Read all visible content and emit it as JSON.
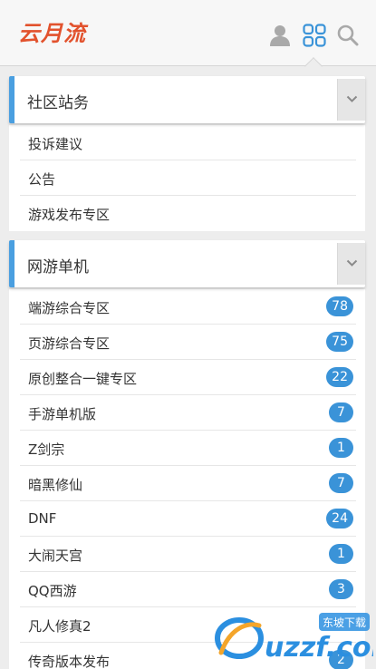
{
  "header": {
    "logo_text": "云月流",
    "icons": [
      "user-icon",
      "apps-grid-icon",
      "search-icon"
    ],
    "accent_color": "#4a9fe0",
    "logo_color": "#e2522d"
  },
  "sections": [
    {
      "title": "社区站务",
      "items": [
        {
          "label": "投诉建议"
        },
        {
          "label": "公告"
        },
        {
          "label": "游戏发布专区"
        }
      ]
    },
    {
      "title": "网游单机",
      "items": [
        {
          "label": "端游综合专区",
          "count": "78"
        },
        {
          "label": "页游综合专区",
          "count": "75"
        },
        {
          "label": "原创整合一键专区",
          "count": "22"
        },
        {
          "label": "手游单机版",
          "count": "7"
        },
        {
          "label": "Z剑宗",
          "count": "1"
        },
        {
          "label": "暗黑修仙",
          "count": "7"
        },
        {
          "label": "DNF",
          "count": "24"
        },
        {
          "label": "大闹天宫",
          "count": "1"
        },
        {
          "label": "QQ西游",
          "count": "3"
        },
        {
          "label": "凡人修真2",
          "count": ""
        },
        {
          "label": "传奇版本发布",
          "count": "2"
        }
      ]
    }
  ],
  "watermark": {
    "brand": "uzzf.com",
    "tag": "东坡下载"
  }
}
